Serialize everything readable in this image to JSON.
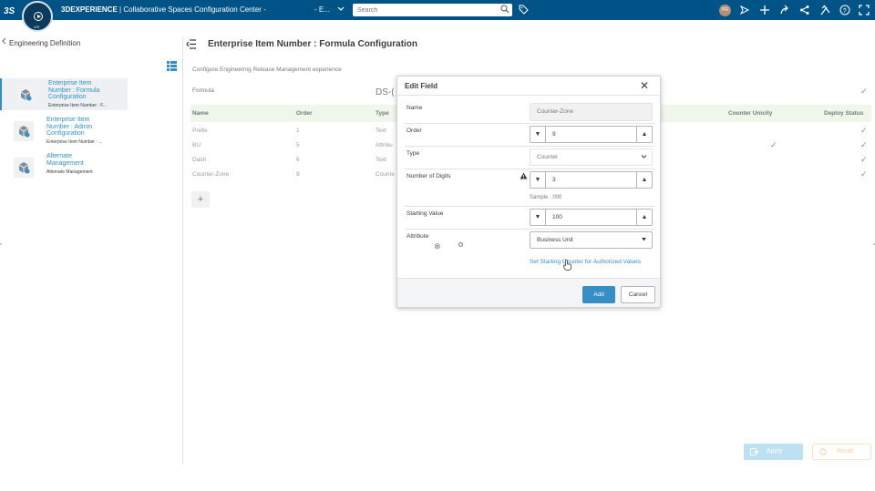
{
  "topbar": {
    "brand_bold": "3DEXPERIENCE",
    "brand_rest": " | Collaborative Spaces Configuration Center -",
    "role": "- E...",
    "search_placeholder": "Search",
    "avatar_initials": "PR",
    "compass_label": "V,R"
  },
  "left_panel": {
    "title": "Engineering Definition",
    "items": [
      {
        "name": "Enterprise Item Number : Formula Configuration",
        "sub": "Enterprise Item Number : F..."
      },
      {
        "name": "Enterprise Item Number : Admin Configuration",
        "sub": "Enterprise Item Number : ..."
      },
      {
        "name": "Alternate Management",
        "sub": "Alternate Management"
      }
    ]
  },
  "main": {
    "title": "Enterprise Item Number : Formula Configuration",
    "description": "Configure Engineering Release Management experience",
    "formula_label": "Formula",
    "formula_value": "DS-(",
    "columns": {
      "name": "Name",
      "order": "Order",
      "type": "Type",
      "counter_unicity": "Counter Unicity",
      "deploy_status": "Deploy Status"
    },
    "rows": [
      {
        "name": "Prefix",
        "order": "1",
        "type": "Text",
        "unicity": false
      },
      {
        "name": "BU",
        "order": "5",
        "type": "Attribu",
        "unicity": true
      },
      {
        "name": "Dash",
        "order": "6",
        "type": "Text",
        "unicity": false
      },
      {
        "name": "Counter-Zone",
        "order": "9",
        "type": "Counte",
        "unicity": false
      }
    ],
    "add_symbol": "+",
    "apply_label": "Apply",
    "reset_label": "Reset"
  },
  "modal": {
    "title": "Edit Field",
    "close_symbol": "✕",
    "name_label": "Name",
    "name_value": "Counter-Zone",
    "order_label": "Order",
    "order_value": "9",
    "type_label": "Type",
    "type_value": "Counter",
    "digits_label": "Number of Digits",
    "digits_value": "3",
    "sample_text": "Sample : 000",
    "start_label": "Starting Value",
    "start_value": "100",
    "attribute_label": "Attribute",
    "attribute_value": "Business Unit",
    "set_link": "Set Starting Counter for Authorized Values",
    "add_label": "Add",
    "cancel_label": "Cancel"
  },
  "colors": {
    "topbar": "#005386",
    "accent": "#368ec4",
    "success": "#57b847"
  }
}
